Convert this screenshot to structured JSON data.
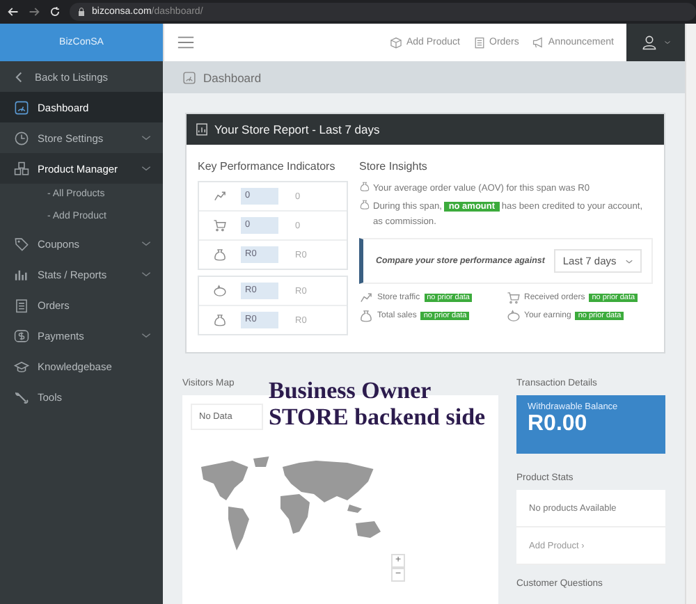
{
  "browser": {
    "url_host": "bizconsa.com",
    "url_path": "/dashboard/"
  },
  "sidebar": {
    "logo": "BizConSA",
    "items": [
      {
        "label": "Back to Listings",
        "selected": false,
        "has_submenu": false,
        "expanded": false
      },
      {
        "label": "Dashboard",
        "selected": true,
        "has_submenu": false,
        "expanded": false
      },
      {
        "label": "Store Settings",
        "selected": false,
        "has_submenu": true,
        "expanded": false
      },
      {
        "label": "Product Manager",
        "selected": false,
        "has_submenu": true,
        "expanded": true,
        "children": [
          {
            "label": "- All Products"
          },
          {
            "label": "- Add Product"
          }
        ]
      },
      {
        "label": "Coupons",
        "selected": false,
        "has_submenu": true,
        "expanded": false
      },
      {
        "label": "Stats / Reports",
        "selected": false,
        "has_submenu": true,
        "expanded": false
      },
      {
        "label": "Orders",
        "selected": false,
        "has_submenu": false,
        "expanded": false
      },
      {
        "label": "Payments",
        "selected": false,
        "has_submenu": true,
        "expanded": false
      },
      {
        "label": "Knowledgebase",
        "selected": false,
        "has_submenu": false,
        "expanded": false
      },
      {
        "label": "Tools",
        "selected": false,
        "has_submenu": false,
        "expanded": false
      }
    ]
  },
  "header": {
    "actions": [
      {
        "label": "Add Product"
      },
      {
        "label": "Orders"
      },
      {
        "label": "Announcement"
      }
    ]
  },
  "breadcrumb": {
    "title": "Dashboard"
  },
  "report": {
    "title": "Your Store Report - Last 7 days",
    "kpi_title": "Key Performance Indicators",
    "kpi_groups": [
      [
        {
          "value": "0",
          "previous": "0"
        },
        {
          "value": "0",
          "previous": "0"
        },
        {
          "value": "R0",
          "previous": "R0"
        }
      ],
      [
        {
          "value": "R0",
          "previous": "R0"
        },
        {
          "value": "R0",
          "previous": "R0"
        }
      ]
    ],
    "insights_title": "Store Insights",
    "aov_text": "Your average order value (AOV) for this span was R0",
    "credit_before": "During this span,",
    "credit_badge": "no amount",
    "credit_after": "has been credited to your account, as commission.",
    "compare_label": "Compare your store performance against",
    "compare_value": "Last 7 days",
    "stats": [
      {
        "label": "Store traffic",
        "badge": "no prior data"
      },
      {
        "label": "Received orders",
        "badge": "no prior data"
      },
      {
        "label": "Total sales",
        "badge": "no prior data"
      },
      {
        "label": "Your earning",
        "badge": "no prior data"
      }
    ]
  },
  "visitors_map": {
    "title": "Visitors Map",
    "legend": "No Data",
    "zoom_in": "+",
    "zoom_out": "−"
  },
  "overlay_caption": [
    "Business Owner",
    "STORE backend side"
  ],
  "transaction": {
    "title": "Transaction Details",
    "balance_label": "Withdrawable Balance",
    "balance": "R0.00"
  },
  "product_stats": {
    "title": "Product Stats",
    "empty": "No products Available",
    "link": "Add Product ›"
  },
  "customer_questions": {
    "title": "Customer Questions"
  }
}
